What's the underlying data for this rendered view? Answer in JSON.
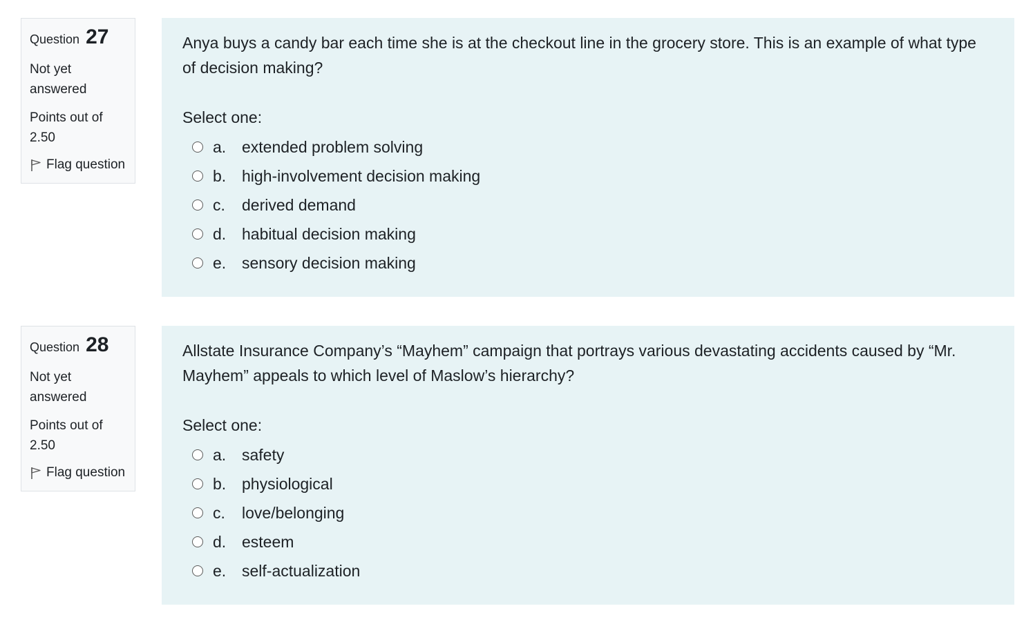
{
  "questions": [
    {
      "label": "Question",
      "number": "27",
      "state": "Not yet answered",
      "grade": "Points out of 2.50",
      "flag_label": "Flag question",
      "text": "Anya buys a candy bar each time she is at the checkout line in the grocery store. This is an example of what type of decision making?",
      "prompt": "Select one:",
      "answers": [
        {
          "letter": "a.",
          "text": "extended problem solving"
        },
        {
          "letter": "b.",
          "text": "high-involvement decision making"
        },
        {
          "letter": "c.",
          "text": "derived demand"
        },
        {
          "letter": "d.",
          "text": "habitual decision making"
        },
        {
          "letter": "e.",
          "text": "sensory decision making"
        }
      ]
    },
    {
      "label": "Question",
      "number": "28",
      "state": "Not yet answered",
      "grade": "Points out of 2.50",
      "flag_label": "Flag question",
      "text": "Allstate Insurance Company’s “Mayhem” campaign that portrays various devastating accidents caused by “Mr. Mayhem” appeals to which level of Maslow’s hierarchy?",
      "prompt": "Select one:",
      "answers": [
        {
          "letter": "a.",
          "text": "safety"
        },
        {
          "letter": "b.",
          "text": "physiological"
        },
        {
          "letter": "c.",
          "text": "love/belonging"
        },
        {
          "letter": "d.",
          "text": "esteem"
        },
        {
          "letter": "e.",
          "text": "self-actualization"
        }
      ]
    }
  ],
  "colors": {
    "info_bg": "#f8f9fa",
    "content_bg": "#e7f3f5",
    "text": "#1d2125",
    "border": "#dee2e6"
  },
  "icons": {
    "flag": "flag-icon",
    "radio": "radio-unchecked-icon"
  }
}
